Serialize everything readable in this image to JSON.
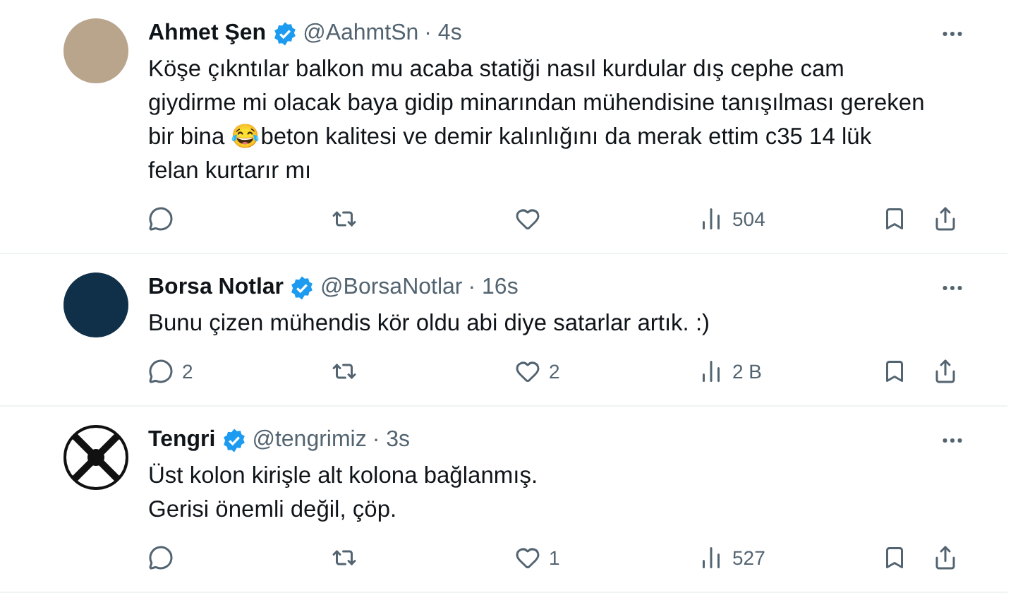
{
  "tweets": [
    {
      "avatar": {
        "kind": "photo"
      },
      "name": "Ahmet Şen",
      "verified": true,
      "handle": "@AahmtSn",
      "time": "· 4s",
      "lines": [
        "Köşe çıkntılar balkon mu acaba statiği nasıl kurdular dış cephe cam",
        "giydirme mi olacak baya gidip minarından mühendisine tanışılması gereken",
        "bir bina 😂beton kalitesi ve demir kalınlığını da merak ettim c35 14 lük",
        "felan kurtarır mı"
      ],
      "views": "504"
    },
    {
      "avatar": {
        "kind": "logo"
      },
      "name": "Borsa Notlar",
      "verified": true,
      "handle": "@BorsaNotlar",
      "time": "· 16s",
      "lines": [
        "Bunu çizen mühendis kör oldu abi diye satarlar artık. :)"
      ],
      "replies": "2",
      "likes": "2",
      "views": "2 B"
    },
    {
      "avatar": {
        "kind": "emblem"
      },
      "name": "Tengri",
      "verified": true,
      "handle": "@tengrimiz",
      "time": "· 3s",
      "lines": [
        "Üst kolon kirişle alt kolona bağlanmış.",
        "Gerisi önemli değil, çöp."
      ],
      "likes": "1",
      "views": "527"
    }
  ]
}
